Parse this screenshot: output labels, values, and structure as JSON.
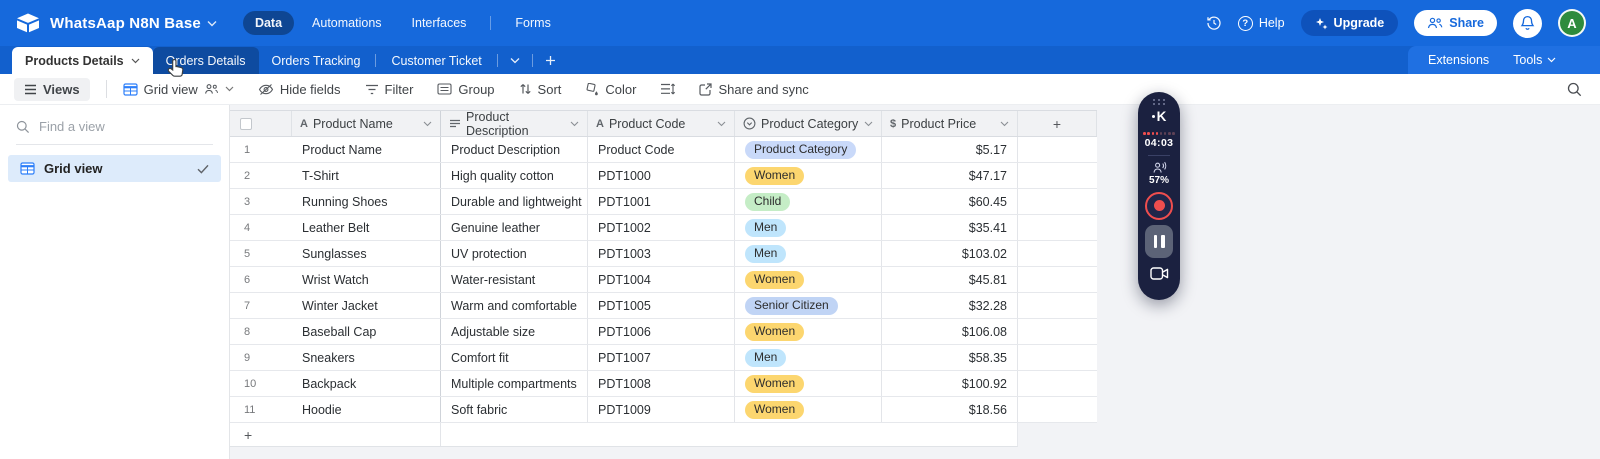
{
  "topbar": {
    "title": "WhatsAap N8N Base",
    "nav": [
      "Data",
      "Automations",
      "Interfaces",
      "Forms"
    ],
    "active_nav": "Data",
    "help_label": "Help",
    "upgrade_label": "Upgrade",
    "share_label": "Share",
    "avatar_letter": "A"
  },
  "tabbar": {
    "tables": [
      "Products Details",
      "Orders Details",
      "Orders Tracking",
      "Customer Ticket"
    ],
    "active_table": "Products Details",
    "hovered_table": "Orders Details",
    "extensions_label": "Extensions",
    "tools_label": "Tools"
  },
  "toolbar": {
    "views_label": "Views",
    "view_name": "Grid view",
    "hide_fields_label": "Hide fields",
    "filter_label": "Filter",
    "group_label": "Group",
    "sort_label": "Sort",
    "color_label": "Color",
    "share_sync_label": "Share and sync"
  },
  "sidebar": {
    "search_placeholder": "Find a view",
    "items": [
      {
        "label": "Grid view",
        "selected": true
      }
    ]
  },
  "table": {
    "add_label": "+",
    "columns": [
      {
        "name": "Product Name",
        "icon": "text-field-icon"
      },
      {
        "name": "Product Description",
        "icon": "long-text-field-icon"
      },
      {
        "name": "Product Code",
        "icon": "text-field-icon"
      },
      {
        "name": "Product Category",
        "icon": "single-select-field-icon"
      },
      {
        "name": "Product Price",
        "icon": "currency-field-icon"
      }
    ],
    "rows": [
      {
        "n": "1",
        "name": "Product Name",
        "desc": "Product Description",
        "code": "Product Code",
        "category": "Product Category",
        "cat_color": "lavender",
        "price": "$5.17"
      },
      {
        "n": "2",
        "name": "T-Shirt",
        "desc": "High quality cotton",
        "code": "PDT1000",
        "category": "Women",
        "cat_color": "amber",
        "price": "$47.17"
      },
      {
        "n": "3",
        "name": "Running Shoes",
        "desc": "Durable and lightweight",
        "code": "PDT1001",
        "category": "Child",
        "cat_color": "green",
        "price": "$60.45"
      },
      {
        "n": "4",
        "name": "Leather Belt",
        "desc": "Genuine leather",
        "code": "PDT1002",
        "category": "Men",
        "cat_color": "sky",
        "price": "$35.41"
      },
      {
        "n": "5",
        "name": "Sunglasses",
        "desc": "UV protection",
        "code": "PDT1003",
        "category": "Men",
        "cat_color": "sky",
        "price": "$103.02"
      },
      {
        "n": "6",
        "name": "Wrist Watch",
        "desc": "Water-resistant",
        "code": "PDT1004",
        "category": "Women",
        "cat_color": "amber",
        "price": "$45.81"
      },
      {
        "n": "7",
        "name": "Winter Jacket",
        "desc": "Warm and comfortable",
        "code": "PDT1005",
        "category": "Senior Citizen",
        "cat_color": "periwinkle",
        "price": "$32.28"
      },
      {
        "n": "8",
        "name": "Baseball Cap",
        "desc": "Adjustable size",
        "code": "PDT1006",
        "category": "Women",
        "cat_color": "amber",
        "price": "$106.08"
      },
      {
        "n": "9",
        "name": "Sneakers",
        "desc": "Comfort fit",
        "code": "PDT1007",
        "category": "Men",
        "cat_color": "sky",
        "price": "$58.35"
      },
      {
        "n": "10",
        "name": "Backpack",
        "desc": "Multiple compartments",
        "code": "PDT1008",
        "category": "Women",
        "cat_color": "amber",
        "price": "$100.92"
      },
      {
        "n": "11",
        "name": "Hoodie",
        "desc": "Soft fabric",
        "code": "PDT1009",
        "category": "Women",
        "cat_color": "amber",
        "price": "$18.56"
      }
    ]
  },
  "recorder": {
    "logo": "K",
    "timer": "04:03",
    "mic_level": "57%"
  },
  "colors": {
    "topbar_blue": "#1669dc",
    "accent_blue": "#2d7ff9",
    "avatar_green": "#2e8b3d",
    "record_red": "#ef4e4e",
    "pills": {
      "lavender": "#c9d9f9",
      "amber": "#fcd66f",
      "green": "#c5edc6",
      "sky": "#bfe5fc",
      "periwinkle": "#c0d4f5"
    }
  }
}
